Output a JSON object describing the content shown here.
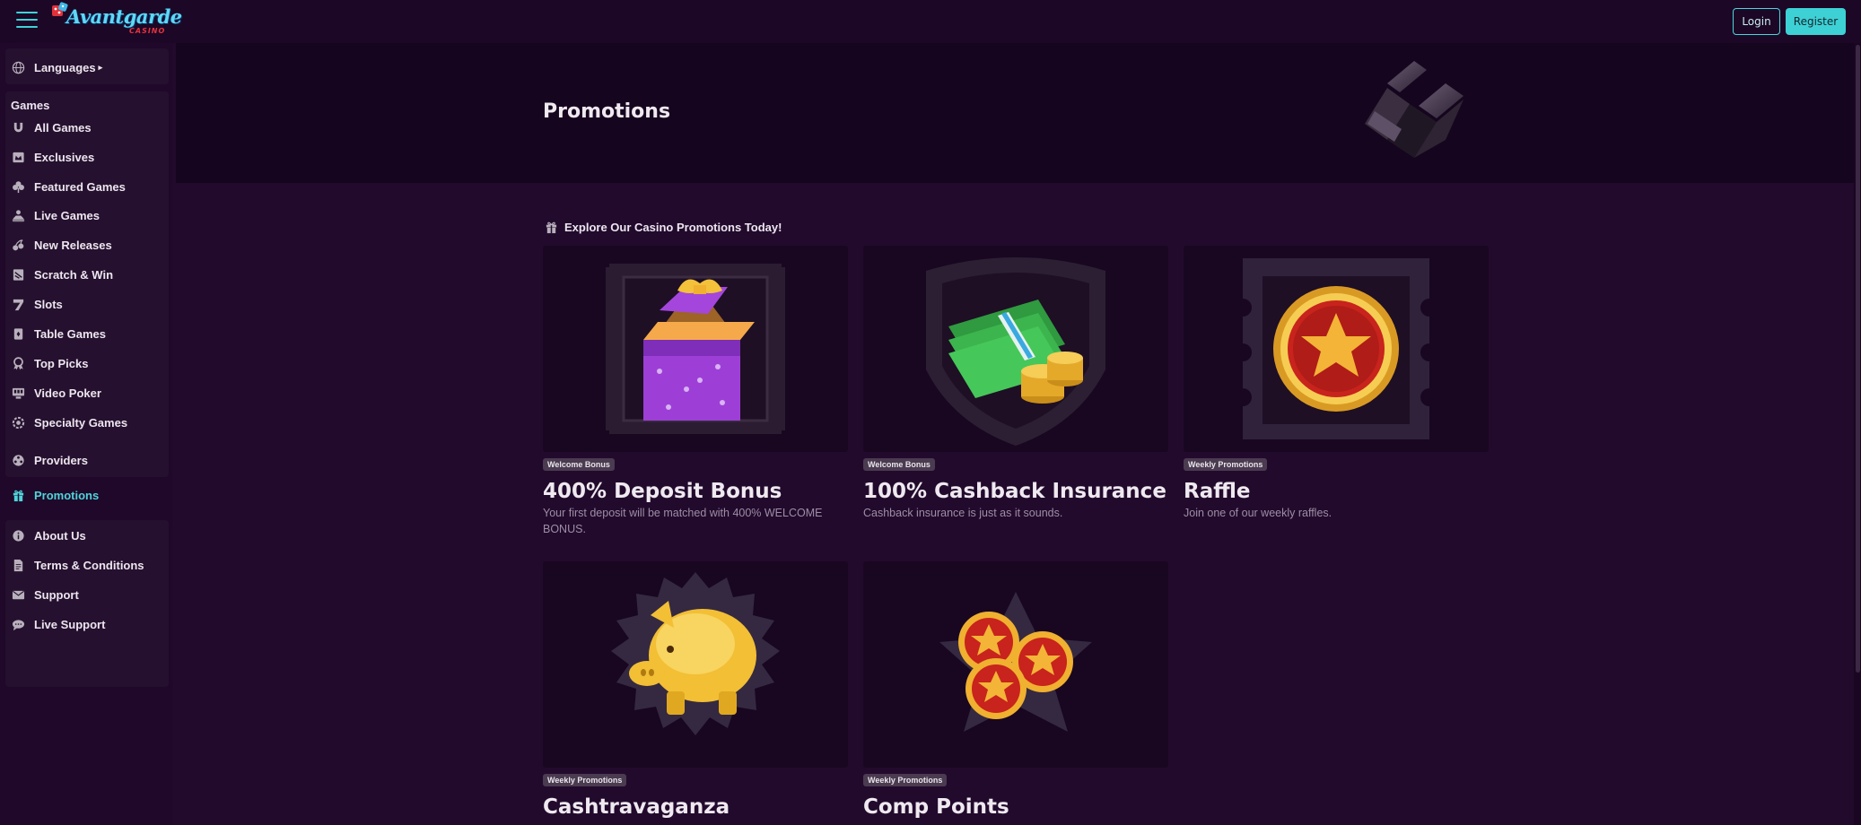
{
  "header": {
    "logo_text": "Avantgarde",
    "logo_sub": "CASINO",
    "login_label": "Login",
    "register_label": "Register"
  },
  "sidebar": {
    "languages_label": "Languages",
    "games_heading": "Games",
    "game_items": [
      {
        "label": "All Games",
        "icon": "horseshoe-icon"
      },
      {
        "label": "Exclusives",
        "icon": "crown-card-icon"
      },
      {
        "label": "Featured Games",
        "icon": "clover-icon"
      },
      {
        "label": "Live Games",
        "icon": "dealer-icon"
      },
      {
        "label": "New Releases",
        "icon": "cherries-icon"
      },
      {
        "label": "Scratch & Win",
        "icon": "scratch-card-icon"
      },
      {
        "label": "Slots",
        "icon": "seven-icon"
      },
      {
        "label": "Table Games",
        "icon": "cards-icon"
      },
      {
        "label": "Top Picks",
        "icon": "award-icon"
      },
      {
        "label": "Video Poker",
        "icon": "video-poker-icon"
      },
      {
        "label": "Specialty Games",
        "icon": "wheel-icon"
      }
    ],
    "providers_label": "Providers",
    "promotions_label": "Promotions",
    "footer_items": [
      {
        "label": "About Us",
        "icon": "info-icon"
      },
      {
        "label": "Terms & Conditions",
        "icon": "document-icon"
      },
      {
        "label": "Support",
        "icon": "envelope-icon"
      },
      {
        "label": "Live Support",
        "icon": "chat-icon"
      }
    ]
  },
  "hero": {
    "title": "Promotions"
  },
  "section": {
    "label": "Explore Our Casino Promotions Today!"
  },
  "promotions": [
    {
      "badge": "Welcome Bonus",
      "title": "400% Deposit Bonus",
      "description": "Your first deposit will be matched with 400% WELCOME BONUS."
    },
    {
      "badge": "Welcome Bonus",
      "title": "100% Cashback Insurance",
      "description": "Cashback insurance is just as it sounds."
    },
    {
      "badge": "Weekly Promotions",
      "title": "Raffle",
      "description": "Join one of our weekly raffles."
    },
    {
      "badge": "Weekly Promotions",
      "title": "Cashtravaganza",
      "description": ""
    },
    {
      "badge": "Weekly Promotions",
      "title": "Comp Points",
      "description": ""
    }
  ],
  "colors": {
    "accent": "#3dd1d5",
    "background": "#220a2d",
    "sidebar": "#1f0829",
    "hero": "#16051e"
  }
}
